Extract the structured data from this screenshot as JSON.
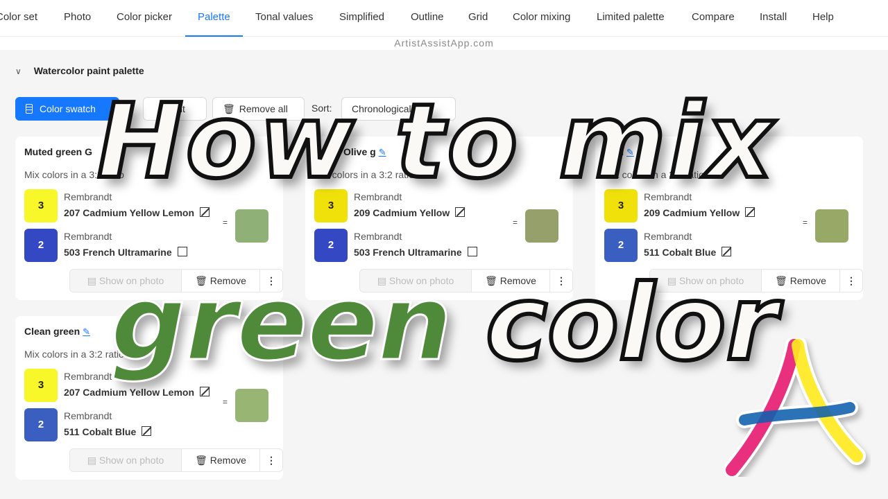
{
  "nav": {
    "tabs": [
      {
        "label": "Color set"
      },
      {
        "label": "Photo"
      },
      {
        "label": "Color picker"
      },
      {
        "label": "Palette",
        "active": true
      },
      {
        "label": "Tonal values"
      },
      {
        "label": "Simplified"
      },
      {
        "label": "Outline"
      },
      {
        "label": "Grid"
      },
      {
        "label": "Color mixing"
      },
      {
        "label": "Limited palette"
      },
      {
        "label": "Compare"
      },
      {
        "label": "Install"
      },
      {
        "label": "Help"
      }
    ],
    "site_label": "ArtistAssistApp.com"
  },
  "section": {
    "title": "Watercolor paint palette",
    "chevron_icon": "chevron-down-icon"
  },
  "toolbar": {
    "color_swatch_label": "Color swatch",
    "paint_label": "Paint",
    "remove_all_label": "Remove all",
    "sort_label": "Sort:",
    "sort_value": "Chronologically"
  },
  "cards": [
    {
      "title": "Muted green G",
      "description": "Mix colors in a 3:2 ratio",
      "paints": [
        {
          "parts": "3",
          "brand": "Rembrandt",
          "name": "207 Cadmium Yellow Lemon",
          "color": "#f7f72a",
          "text_color": "#222",
          "checkbox": "slash"
        },
        {
          "parts": "2",
          "brand": "Rembrandt",
          "name": "503 French Ultramarine",
          "color": "#3548c4",
          "text_color": "#fff",
          "checkbox": "empty"
        }
      ],
      "result_color": "#8fb077",
      "show_on_photo": "Show on photo",
      "remove": "Remove"
    },
    {
      "title": "green Olive g",
      "description": "Mix colors in a 3:2 ratio",
      "paints": [
        {
          "parts": "3",
          "brand": "Rembrandt",
          "name": "209 Cadmium Yellow",
          "color": "#f1e10a",
          "text_color": "#222",
          "checkbox": "slash"
        },
        {
          "parts": "2",
          "brand": "Rembrandt",
          "name": "503 French Ultramarine",
          "color": "#3548c4",
          "text_color": "#fff",
          "checkbox": "empty"
        }
      ],
      "result_color": "#95a06a",
      "show_on_photo": "Show on photo",
      "remove": "Remove"
    },
    {
      "title": "sy    n",
      "description": "Mix colors in a 3:2 ratio",
      "paints": [
        {
          "parts": "3",
          "brand": "Rembrandt",
          "name": "209 Cadmium Yellow",
          "color": "#f1e10a",
          "text_color": "#222",
          "checkbox": "slash"
        },
        {
          "parts": "2",
          "brand": "Rembrandt",
          "name": "511 Cobalt Blue",
          "color": "#3a5fc0",
          "text_color": "#fff",
          "checkbox": "slash"
        }
      ],
      "result_color": "#98a866",
      "show_on_photo": "Show on photo",
      "remove": "Remove"
    },
    {
      "title": "Clean green",
      "description": "Mix colors in a 3:2 ratio",
      "paints": [
        {
          "parts": "3",
          "brand": "Rembrandt",
          "name": "207 Cadmium Yellow Lemon",
          "color": "#f7f72a",
          "text_color": "#222",
          "checkbox": "slash"
        },
        {
          "parts": "2",
          "brand": "Rembrandt",
          "name": "511 Cobalt Blue",
          "color": "#3a5fc0",
          "text_color": "#fff",
          "checkbox": "slash"
        }
      ],
      "result_color": "#98b574",
      "show_on_photo": "Show on photo",
      "remove": "Remove"
    }
  ],
  "overlay": {
    "line1": "How to mix",
    "line2_green": "green",
    "line2_white": "color",
    "green_color": "#4f8a3a"
  },
  "colors": {
    "accent": "#1677ff"
  }
}
